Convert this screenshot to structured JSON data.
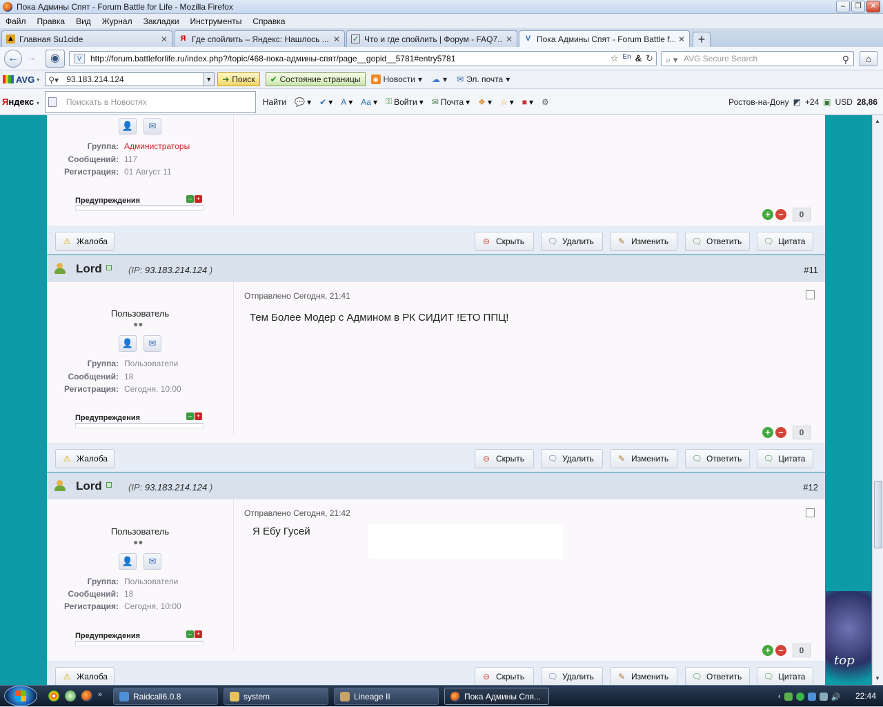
{
  "window": {
    "title": "Пока Админы Спят - Forum Battle for Life - Mozilla Firefox"
  },
  "menu": [
    "Файл",
    "Правка",
    "Вид",
    "Журнал",
    "Закладки",
    "Инструменты",
    "Справка"
  ],
  "tabs": [
    {
      "label": "Главная Su1cide",
      "icon": "hazard-icon"
    },
    {
      "label": "Где спойлить – Яндекс: Нашлось ...",
      "icon": "yandex-icon"
    },
    {
      "label": "Что и где спойлить | Форум - FAQ7...",
      "icon": "checkbox-icon"
    },
    {
      "label": "Пока Админы Спят - Forum Battle f...",
      "icon": "forum-icon"
    }
  ],
  "nav": {
    "url": "http://forum.battleforlife.ru/index.php?/topic/468-пока-админы-спят/page__gopid__5781#entry5781",
    "search_placeholder": "AVG Secure Search"
  },
  "avg": {
    "logo": "AVG",
    "search_value": "93.183.214.124",
    "search_button": "Поиск",
    "page_status": "Состояние страницы",
    "news": "Новости",
    "mail": "Эл. почта"
  },
  "yandex": {
    "logo_red": "Я",
    "logo_black": "ндекс",
    "search_placeholder": "Поискать в Новостях",
    "find": "Найти",
    "login": "Войти",
    "mail": "Почта",
    "city": "Ростов-на-Дону",
    "temp": "+24",
    "currency_label": "USD",
    "currency_value": "28,86"
  },
  "labels": {
    "group": "Группа:",
    "messages": "Сообщений:",
    "registration": "Регистрация:",
    "warnings": "Предупреждения",
    "complaint": "Жалоба",
    "hide": "Скрыть",
    "delete": "Удалить",
    "edit": "Изменить",
    "reply": "Ответить",
    "quote": "Цитата",
    "ip_prefix": "IP:"
  },
  "posts": [
    {
      "group": "Администраторы",
      "messages": "117",
      "registered": "01 Август 11",
      "rating": "0"
    },
    {
      "author": "Lord",
      "ip": "93.183.214.124",
      "number": "#11",
      "role": "Пользователь",
      "posted": "Отправлено Сегодня, 21:41",
      "text": "Тем Более Модер с Админом в РК СИДИТ !ЕТО ППЦ!",
      "group": "Пользователи",
      "messages": "18",
      "registered": "Сегодня, 10:00",
      "rating": "0"
    },
    {
      "author": "Lord",
      "ip": "93.183.214.124",
      "number": "#12",
      "role": "Пользователь",
      "posted": "Отправлено Сегодня, 21:42",
      "text": "Я Ебу Гусей",
      "group": "Пользователи",
      "messages": "18",
      "registered": "Сегодня, 10:00",
      "rating": "0"
    }
  ],
  "taskbar": {
    "tasks": [
      "Raidcall6.0.8",
      "system",
      "Lineage II",
      "Пока Админы Спя..."
    ],
    "clock": "22:44"
  }
}
